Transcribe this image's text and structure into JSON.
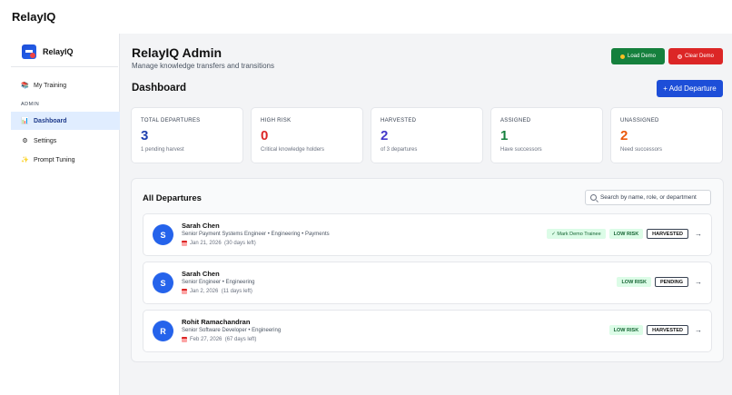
{
  "app": {
    "title": "RelayIQ"
  },
  "sidebar": {
    "brand": "RelayIQ",
    "items": [
      {
        "label": "My Training",
        "icon": "books-icon"
      }
    ],
    "section_label": "ADMIN",
    "admin_items": [
      {
        "label": "Dashboard",
        "icon": "bar-chart-icon",
        "active": true
      },
      {
        "label": "Settings",
        "icon": "gear-icon"
      },
      {
        "label": "Prompt Tuning",
        "icon": "sparkle-icon"
      }
    ]
  },
  "header": {
    "title": "RelayIQ Admin",
    "subtitle": "Manage knowledge transfers and transitions",
    "load_demo": "Load Demo",
    "clear_demo": "Clear Demo"
  },
  "dashboard": {
    "title": "Dashboard",
    "add_button": "+ Add Departure"
  },
  "stats": [
    {
      "label": "TOTAL DEPARTURES",
      "value": "3",
      "sub": "1 pending harvest",
      "color": "#1e40af"
    },
    {
      "label": "HIGH RISK",
      "value": "0",
      "sub": "Critical knowledge holders",
      "color": "#dc2626"
    },
    {
      "label": "HARVESTED",
      "value": "2",
      "sub": "of 3 departures",
      "color": "#4338ca"
    },
    {
      "label": "ASSIGNED",
      "value": "1",
      "sub": "Have successors",
      "color": "#15803d"
    },
    {
      "label": "UNASSIGNED",
      "value": "2",
      "sub": "Need successors",
      "color": "#ea580c"
    }
  ],
  "departures": {
    "title": "All Departures",
    "search_placeholder": "Search by name, role, or department",
    "rows": [
      {
        "initial": "S",
        "name": "Sarah Chen",
        "role": "Senior Payment Systems Engineer • Engineering • Payments",
        "date": "Jan 21, 2026  (30 days left)",
        "trainee": "✓ Mark Demo Trainee",
        "risk": "LOW RISK",
        "status": "HARVESTED"
      },
      {
        "initial": "S",
        "name": "Sarah Chen",
        "role": "Senior Engineer • Engineering",
        "date": "Jan 2, 2026  (11 days left)",
        "trainee": "",
        "risk": "LOW RISK",
        "status": "PENDING"
      },
      {
        "initial": "R",
        "name": "Rohit Ramachandran",
        "role": "Senior Software Developer • Engineering",
        "date": "Feb 27, 2026  (67 days left)",
        "trainee": "",
        "risk": "LOW RISK",
        "status": "HARVESTED"
      }
    ]
  }
}
